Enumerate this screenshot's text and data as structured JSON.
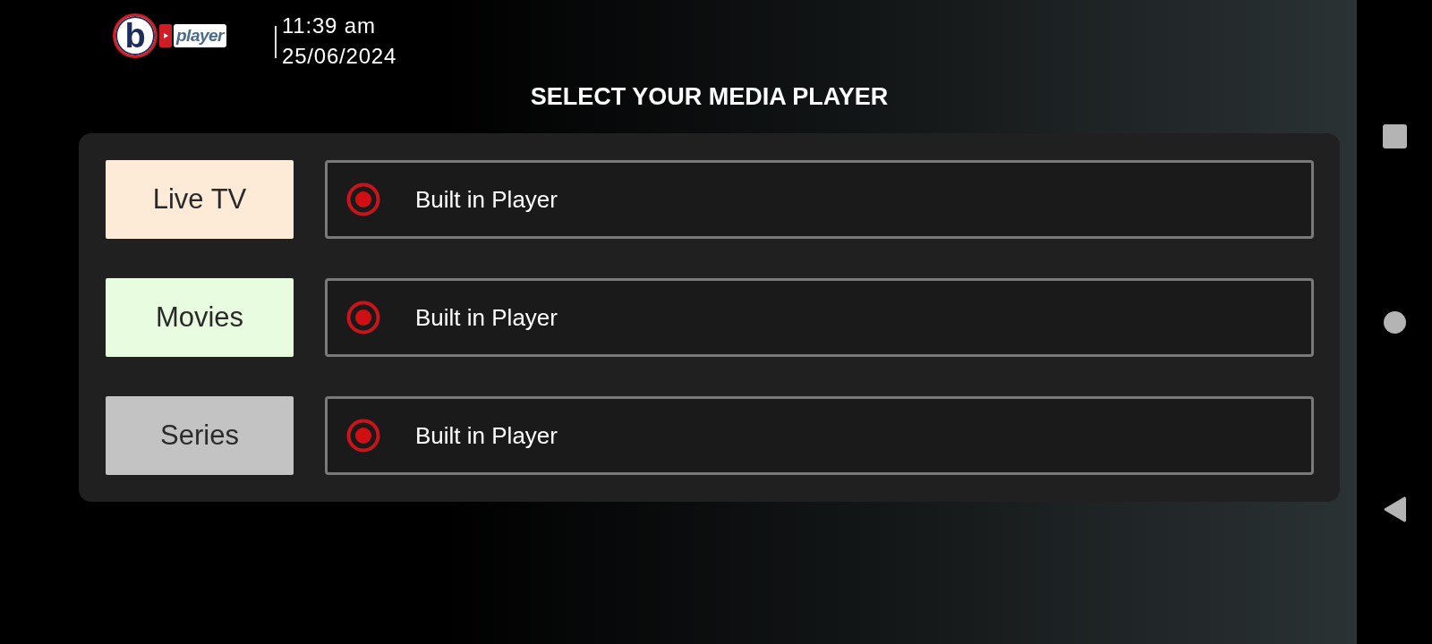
{
  "header": {
    "logo": {
      "letter": "b",
      "tag": "player"
    },
    "time": "11:39 am",
    "date": "25/06/2024"
  },
  "title": "SELECT YOUR MEDIA PLAYER",
  "rows": [
    {
      "category": "Live TV",
      "color": "#fdebd8",
      "player": {
        "label": "Built in Player",
        "selected": true
      }
    },
    {
      "category": "Movies",
      "color": "#e8fcdf",
      "player": {
        "label": "Built in Player",
        "selected": true
      }
    },
    {
      "category": "Series",
      "color": "#c3c3c3",
      "player": {
        "label": "Built in Player",
        "selected": true
      }
    }
  ]
}
